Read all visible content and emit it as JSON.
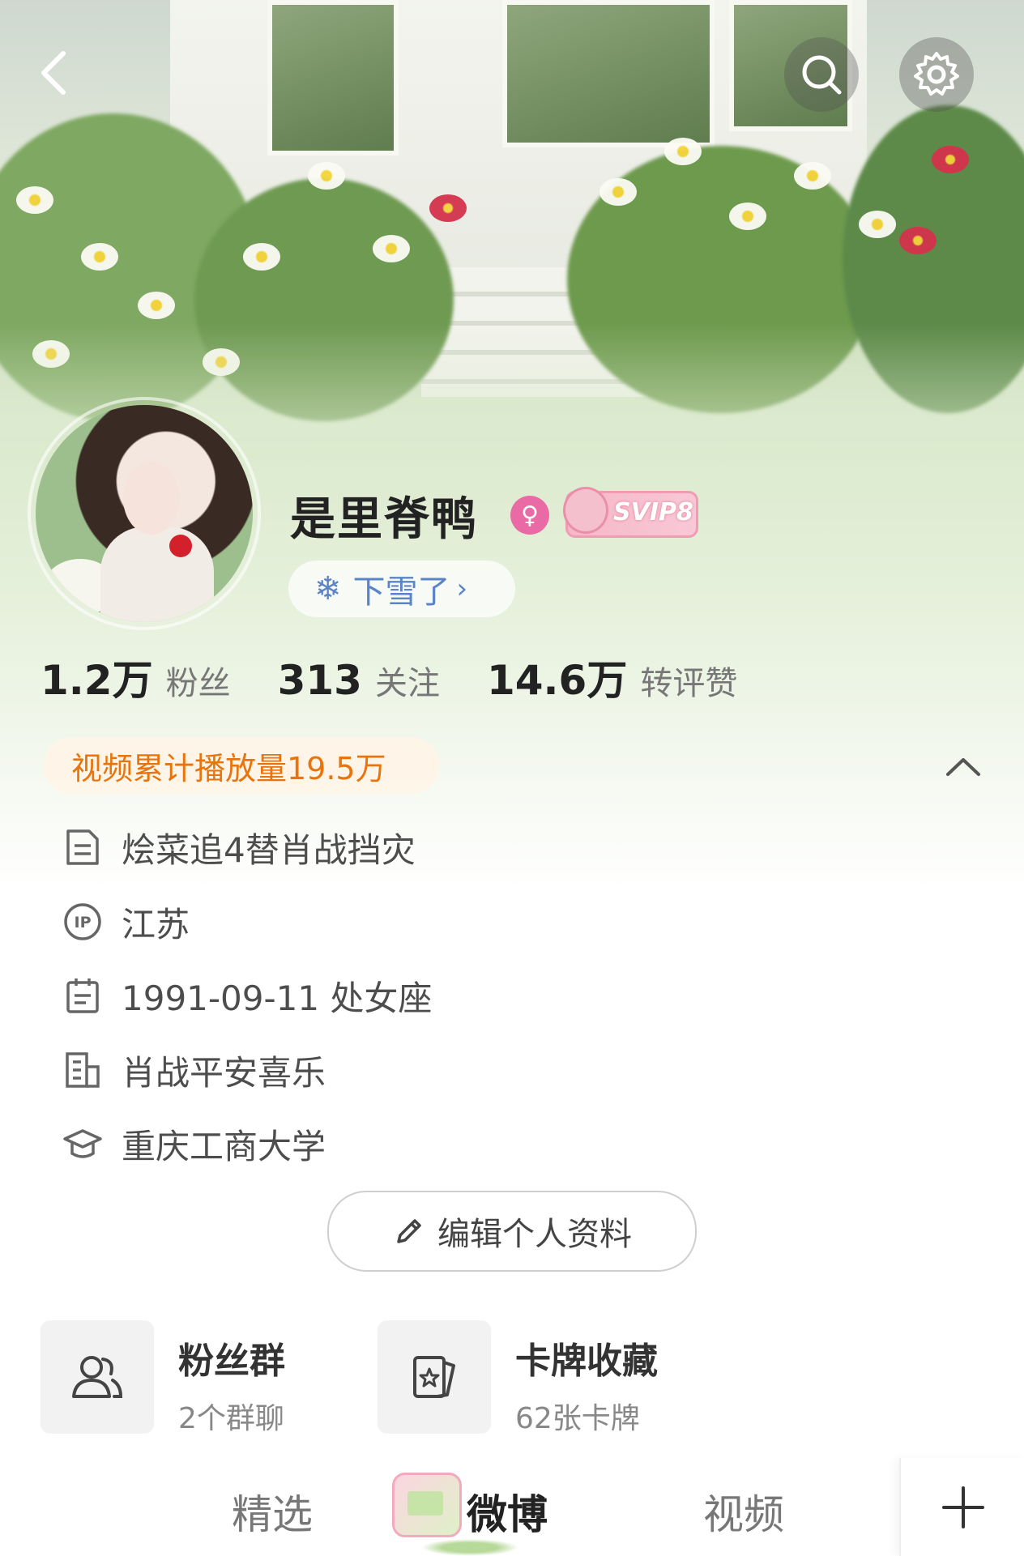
{
  "header": {
    "back_icon": "chevron-left-icon",
    "search_icon": "search-icon",
    "settings_icon": "gear-icon"
  },
  "profile": {
    "name": "是里脊鸭",
    "gender_icon": "female-icon",
    "vip_badge": "SVIP8",
    "weather": "下雪了",
    "stats": [
      {
        "value": "1.2万",
        "label": "粉丝"
      },
      {
        "value": "313",
        "label": "关注"
      },
      {
        "value": "14.6万",
        "label": "转评赞"
      }
    ],
    "video_plays": "视频累计播放量19.5万",
    "info": {
      "bio": "烩菜追4替肖战挡灾",
      "ip": "江苏",
      "birthday": "1991-09-11 处女座",
      "company": "肖战平安喜乐",
      "school": "重庆工商大学"
    },
    "edit_button": "编辑个人资料"
  },
  "cards": [
    {
      "title": "粉丝群",
      "subtitle": "2个群聊",
      "icon": "group-icon"
    },
    {
      "title": "卡牌收藏",
      "subtitle": "62张卡牌",
      "icon": "card-icon"
    }
  ],
  "tabs": [
    {
      "label": "精选",
      "active": false
    },
    {
      "label": "微博",
      "active": true
    },
    {
      "label": "视频",
      "active": false
    }
  ],
  "colors": {
    "accent_orange": "#e8740e",
    "weather_blue": "#5a84c7",
    "gender_pink": "#e96aa4"
  }
}
